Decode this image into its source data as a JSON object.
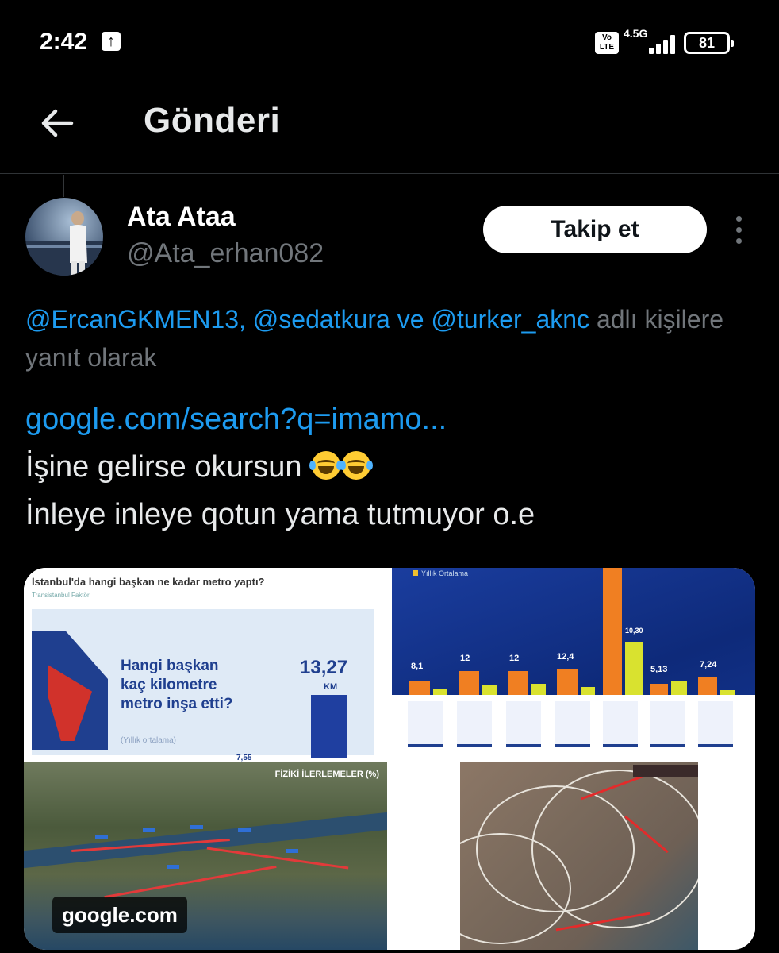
{
  "status_bar": {
    "time": "2:42",
    "upload_glyph": "↑",
    "volte": "Vo\nLTE",
    "network": "4.5G",
    "battery": "81"
  },
  "header": {
    "title": "Gönderi",
    "back_icon": "arrow-left-icon"
  },
  "author": {
    "name": "Ata Ataa",
    "handle": "@Ata_erhan082",
    "follow_label": "Takip et"
  },
  "reply_context": {
    "mention1": "@ErcanGKMEN13,",
    "mention2": "@sedatkura",
    "joiner": "ve",
    "mention3": "@turker_aknc",
    "suffix": "adlı kişilere yanıt olarak"
  },
  "tweet": {
    "link": "google.com/search?q=imamo...",
    "line1": "İşine gelirse okursun",
    "line2": "İnleye inleye qotun yama tutmuyor o.e"
  },
  "media": {
    "img1": {
      "title": "İstanbul'da hangi başkan ne kadar metro yaptı?",
      "subtitle": "Transistanbul Faktör",
      "headline_1": "Hangi başkan",
      "headline_2": "kaç kilometre",
      "headline_3": "metro inşa etti?",
      "caption": "(Yıllık ortalama)",
      "value_big": "13,27",
      "unit": "KM",
      "value_small": "7,55"
    },
    "img2": {
      "legend": "Yıllık Ortalama",
      "values": [
        "8,1",
        "12",
        "12",
        "12,4",
        "10,30",
        "5,13",
        "7,24"
      ]
    },
    "img3": {
      "title": "FİZİKİ İLERLEMELER (%)",
      "badge": "google.com"
    }
  }
}
